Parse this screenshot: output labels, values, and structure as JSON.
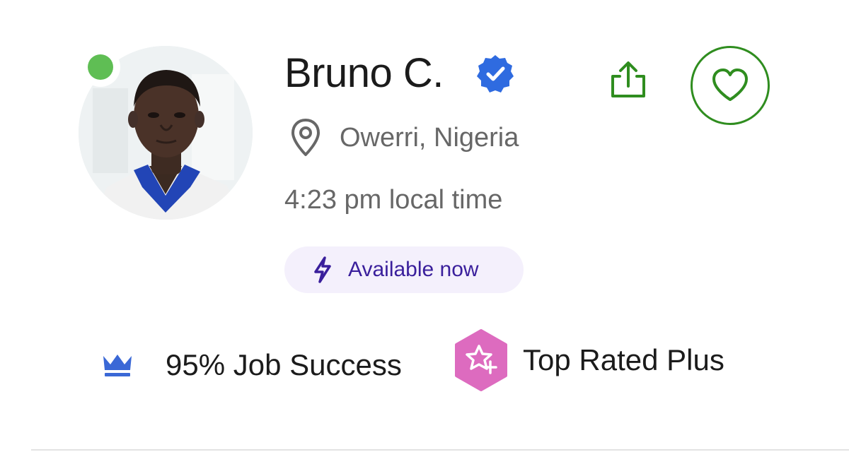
{
  "profile": {
    "name": "Bruno C.",
    "location": "Owerri, Nigeria",
    "local_time": "4:23 pm local time",
    "availability": "Available now",
    "online": true,
    "verified": true
  },
  "stats": {
    "job_success": "95% Job Success",
    "badge": "Top Rated Plus"
  },
  "icons": {
    "online_status": "online-status-dot",
    "verified": "verified-badge-icon",
    "location": "map-pin-icon",
    "availability": "lightning-bolt-icon",
    "share": "share-icon",
    "save": "heart-icon",
    "job_success": "crown-icon",
    "top_rated": "star-badge-icon"
  },
  "colors": {
    "online": "#5fbe54",
    "verified": "#2f6be0",
    "action_green": "#2f8d1f",
    "availability_bg": "#f4f0fc",
    "availability_text": "#3a1f9c",
    "job_success_icon": "#3a68d6",
    "top_rated_badge": "#dd6bbf",
    "secondary_text": "#676767"
  }
}
